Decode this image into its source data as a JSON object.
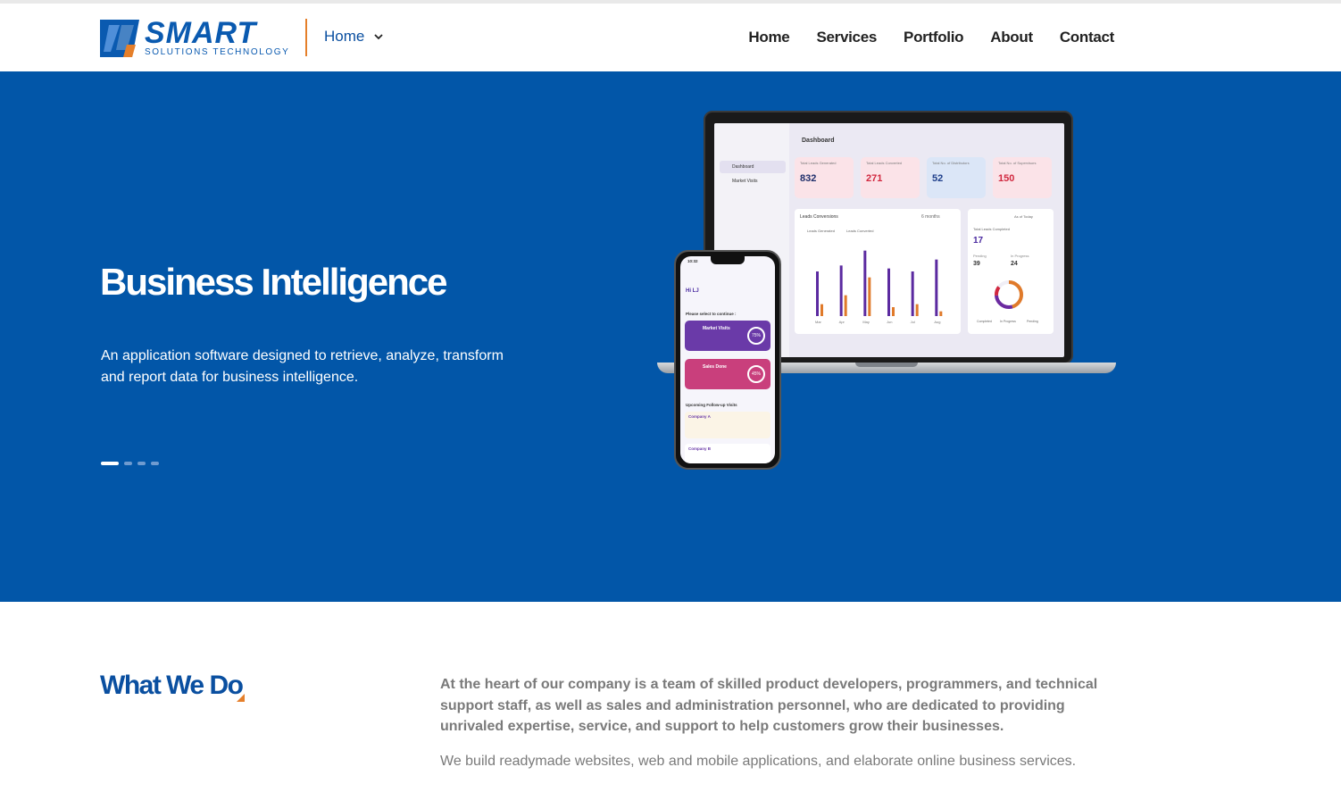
{
  "brand": {
    "name": "SMART",
    "tagline": "SOLUTIONS TECHNOLOGY",
    "primary_color": "#0a5ab0",
    "accent_color": "#e57f2a"
  },
  "header": {
    "dropdown_label": "Home",
    "nav": [
      "Home",
      "Services",
      "Portfolio",
      "About",
      "Contact"
    ]
  },
  "hero": {
    "background": "#0256a8",
    "title": "Business Intelligence",
    "description": "An application software designed to retrieve, analyze, transform and report data for business intelligence.",
    "slides_count": 4,
    "active_slide": 1
  },
  "mockup": {
    "dashboard_title": "Dashboard",
    "sidebar_items": [
      "Dashboard",
      "Market Visits"
    ],
    "kpis": [
      {
        "label": "Total Leads Generated",
        "value": "832",
        "color": "#1f2f6b",
        "bg": "#fbe3e8"
      },
      {
        "label": "Total Leads Converted",
        "value": "271",
        "color": "#d1283f",
        "bg": "#fbe3e8"
      },
      {
        "label": "Total No. of Distributors",
        "value": "52",
        "color": "#1f3f8b",
        "bg": "#dbe6f7"
      },
      {
        "label": "Total No. of Supervisors",
        "value": "150",
        "color": "#d1283f",
        "bg": "#fbe3e8"
      }
    ],
    "leads_title": "Leads Conversions",
    "leads_filter": "6 months",
    "leads_legend": [
      "Leads Generated",
      "Leads Converted"
    ],
    "chart_months": [
      "Mar",
      "Apr",
      "May",
      "Jun",
      "Jul",
      "Aug"
    ],
    "chart_generated": [
      75,
      85,
      110,
      80,
      75,
      95
    ],
    "chart_converted": [
      20,
      35,
      65,
      15,
      20,
      8
    ],
    "today_title": "As of Today",
    "visits_title": "Total Leads Completed",
    "visits_value": "17",
    "pending_label": "Pending",
    "pending_value": "39",
    "inprogress_label": "In Progress",
    "inprogress_value": "24",
    "status_legend": [
      "Completed",
      "In Progress",
      "Pending"
    ],
    "phone": {
      "time": "10:32",
      "greeting": "Hi LJ",
      "prompt": "Please select to continue :",
      "card1_title": "Market Visits",
      "card1_pct": "75%",
      "card2_title": "Sales Done",
      "card2_pct": "45%",
      "followup_title": "Upcoming Follow-up Visits",
      "company_a": "Company A",
      "company_b": "Company B"
    }
  },
  "what_we_do": {
    "title": "What We Do",
    "lead": "At the heart of our company is a team of skilled product developers, programmers, and technical support staff, as well as sales and administration personnel, who are dedicated to providing unrivaled expertise, service, and support to help customers grow their businesses.",
    "body": "We build readymade websites, web and mobile applications, and elaborate online business services."
  }
}
